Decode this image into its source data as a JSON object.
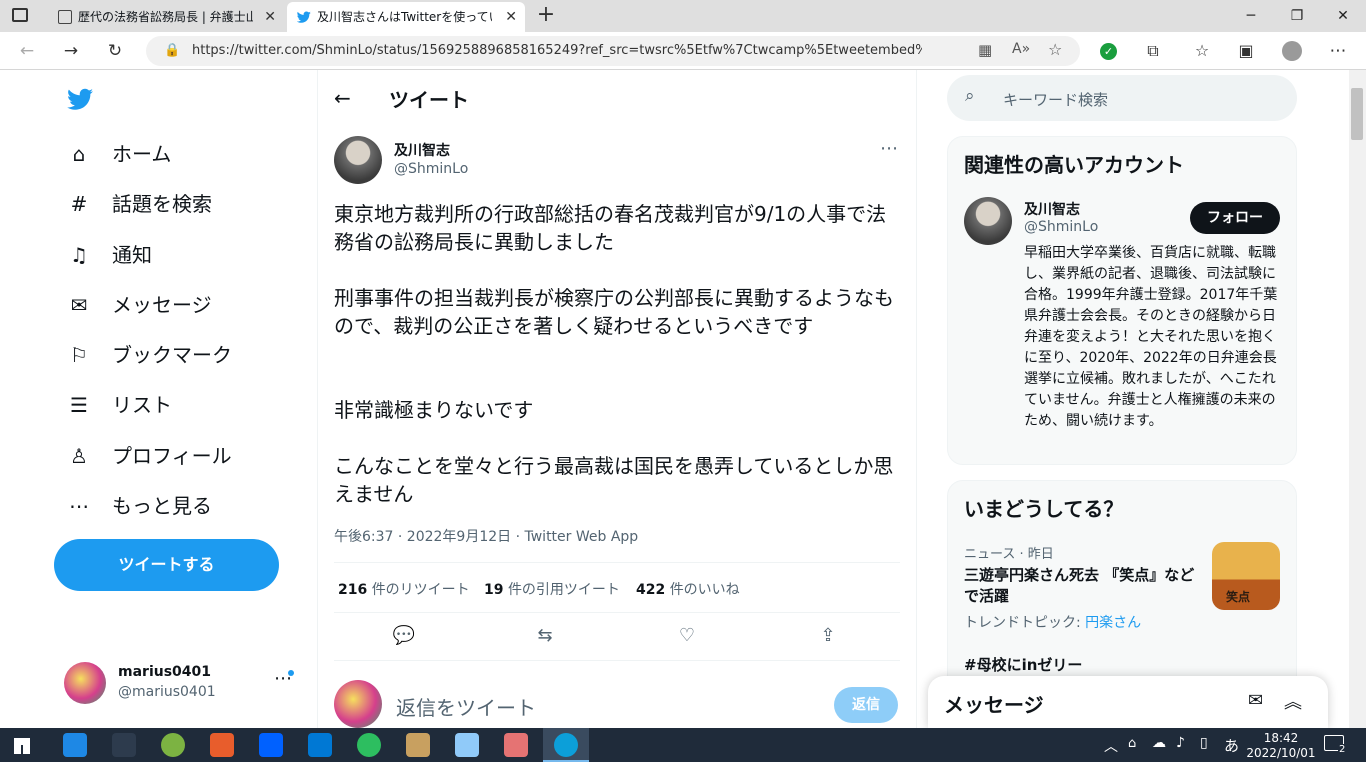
{
  "browser": {
    "tabs": [
      {
        "title": "歴代の法務省訟務局長 | 弁護士山..."
      },
      {
        "title": "及川智志さんはTwitterを使っています"
      }
    ],
    "url": "https://twitter.com/ShminLo/status/1569258896858165249?ref_src=twsrc%5Etfw%7Ctwcamp%5Etweetembed%7Ctwterm%..."
  },
  "nav": {
    "items": [
      {
        "label": "ホーム",
        "icon": "home-icon"
      },
      {
        "label": "話題を検索",
        "icon": "hashtag-icon"
      },
      {
        "label": "通知",
        "icon": "bell-icon"
      },
      {
        "label": "メッセージ",
        "icon": "envelope-icon"
      },
      {
        "label": "ブックマーク",
        "icon": "bookmark-icon"
      },
      {
        "label": "リスト",
        "icon": "list-icon"
      },
      {
        "label": "プロフィール",
        "icon": "person-icon"
      },
      {
        "label": "もっと見る",
        "icon": "more-circle-icon"
      }
    ],
    "tweet_button": "ツイートする",
    "account": {
      "name": "marius0401",
      "handle": "@marius0401"
    }
  },
  "tweet": {
    "header": "ツイート",
    "author_name": "及川智志",
    "author_handle": "@ShminLo",
    "paragraphs": [
      "東京地方裁判所の行政部総括の春名茂裁判官が9/1の人事で法務省の訟務局長に異動しました",
      "刑事事件の担当裁判長が検察庁の公判部長に異動するようなもので、裁判の公正さを著しく疑わせるというべきです",
      "非常識極まりないです",
      "こんなことを堂々と行う最高裁は国民を愚弄しているとしか思えません"
    ],
    "meta": "午後6:37 · 2022年9月12日 · Twitter Web App",
    "stats": [
      {
        "count": "216",
        "label": "件のリツイート"
      },
      {
        "count": "19",
        "label": "件の引用ツイート"
      },
      {
        "count": "422",
        "label": "件のいいね"
      }
    ],
    "reply_placeholder": "返信をツイート",
    "reply_button": "返信"
  },
  "right": {
    "search_placeholder": "キーワード検索",
    "related": {
      "title": "関連性の高いアカウント",
      "name": "及川智志",
      "handle": "@ShminLo",
      "follow": "フォロー",
      "bio": "早稲田大学卒業後、百貨店に就職、転職し、業界紙の記者、退職後、司法試験に合格。1999年弁護士登録。2017年千葉県弁護士会会長。そのときの経験から日弁連を変えよう！と大それた思いを抱くに至り、2020年、2022年の日弁連会長選挙に立候補。敗れましたが、へこたれていません。弁護士と人権擁護の未来のため、闘い続けます。"
    },
    "trends": {
      "title": "いまどうしてる？",
      "item_meta": "ニュース · 昨日",
      "item_title": "三遊亭円楽さん死去 『笑点』などで活躍",
      "item_topic_label": "トレンドトピック:",
      "item_topic": "円楽さん",
      "item_image_text": "笑点",
      "next": "#母校にinゼリー"
    },
    "messages": "メッセージ"
  },
  "taskbar": {
    "time": "18:42",
    "date": "2022/10/01",
    "ime": "あ",
    "notifications": "2"
  }
}
